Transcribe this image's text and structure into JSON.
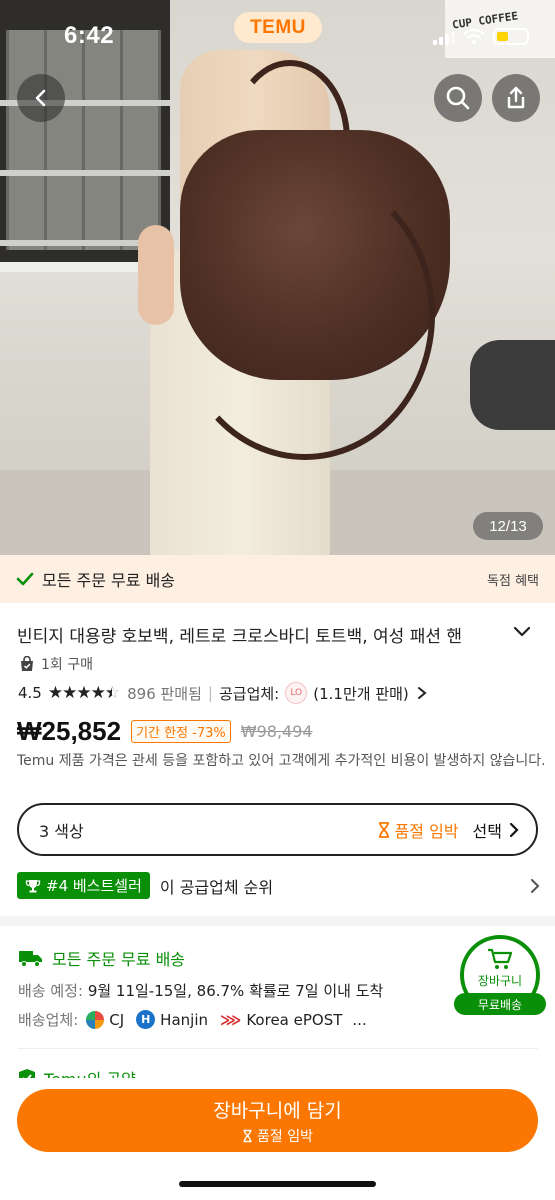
{
  "status_bar": {
    "time": "6:42"
  },
  "header": {
    "logo": "TEMU",
    "image_counter": "12/13"
  },
  "hero_sign": "CUP COFFEE",
  "banner": {
    "text": "모든 주문 무료 배송",
    "right": "독점 혜택"
  },
  "product": {
    "title": "빈티지 대용량 호보백, 레트로 크로스바디 토트백, 여성 패션 핸",
    "purchase_count": "1회 구매",
    "rating": "4.5",
    "sold": "896 판매됨",
    "seller_label": "공급업체:",
    "seller_logo": "LO",
    "seller_sales": "(1.1만개 판매)",
    "rating_value": 4.5,
    "price": "₩25,852",
    "deal_badge": "기간 한정 -73%",
    "old_price": "₩98,494",
    "notice": "Temu 제품 가격은 관세 등을 포함하고 있어 고객에게 추가적인 비용이 발생하지 않습니다."
  },
  "options": {
    "colors": "3 색상",
    "stock": "품절 임박",
    "select": "선택"
  },
  "bestseller": {
    "badge": "#4 베스트셀러",
    "desc": "이 공급업체 순위"
  },
  "shipping": {
    "title": "모든 주문 무료 배송",
    "eta_label": "배송 예정:",
    "eta_value": "9월 11일-15일, 86.7% 확률로 7일 이내 도착",
    "carrier_label": "배송업체:",
    "carriers": [
      "CJ",
      "Hanjin",
      "Korea ePOST"
    ],
    "more": "..."
  },
  "cart_badge": {
    "label": "장바구니",
    "free": "무료배송"
  },
  "pledge": {
    "title": "Temu의 공약"
  },
  "cta": {
    "main": "장바구니에 담기",
    "sub": "품절 임박"
  },
  "colors": {
    "accent": "#fb7701",
    "green": "#0a8f08",
    "banner_bg": "#fdefe2"
  }
}
